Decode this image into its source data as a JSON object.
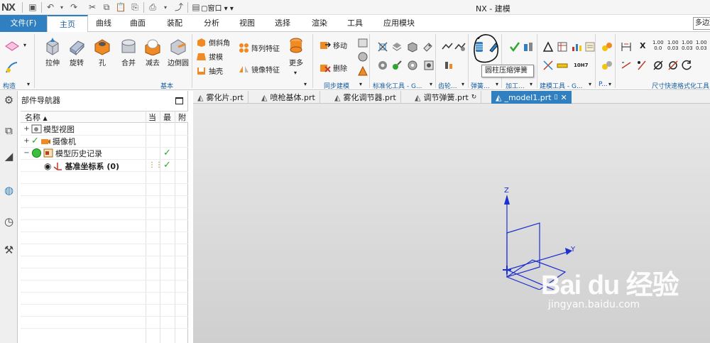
{
  "titlebar": {
    "logo": "NX",
    "title": "NX - 建模",
    "window_menu": "窗口"
  },
  "menubar": {
    "file_tab": "文件(F)",
    "tabs": [
      "主页",
      "曲线",
      "曲面",
      "装配",
      "分析",
      "视图",
      "选择",
      "渲染",
      "工具",
      "应用模块"
    ],
    "search_placeholder": "多边形"
  },
  "ribbon": {
    "group_labels": {
      "construct": "构造",
      "basic": "基本",
      "sync": "同步建模",
      "standard_parts": "标准化工具 - G...",
      "gear": "齿轮...",
      "spring": "弹簧...",
      "machining": "加工...",
      "build_tools": "建模工具 - G...",
      "p": "P...",
      "dimension": "尺寸快速格式化工具"
    },
    "big_buttons": {
      "extrude": "拉伸",
      "revolve": "旋转",
      "hole": "孔",
      "unite": "合并",
      "subtract": "减去",
      "edge_blend": "边倒圆",
      "more": "更多"
    },
    "small_buttons": {
      "chamfer": "倒斜角",
      "draft": "拔模",
      "shell": "抽壳",
      "pattern": "阵列特征",
      "mirror": "镜像特征",
      "move": "移动",
      "delete": "删除"
    },
    "dim_labels": {
      "x": "X",
      "d1": "1.00",
      "d2": "1.00",
      "d3": "1.00",
      "d4": "1.00",
      "d1b": "0.0",
      "d2b": "0.03",
      "d3b": "0.03",
      "d4b": "0.03"
    },
    "fit_label": "10H7",
    "tooltip": "圆柱压缩弹簧"
  },
  "navigator": {
    "title": "部件导航器",
    "columns": {
      "name": "名称",
      "current": "当",
      "latest": "最",
      "attached": "附"
    },
    "rows": {
      "model_views": "模型视图",
      "cameras": "摄像机",
      "model_history": "模型历史记录",
      "datum_csys": "基准坐标系 (0)"
    }
  },
  "file_tabs": [
    "雾化片.prt",
    "喷枪基体.prt",
    "雾化调节器.prt",
    "调节弹簧.prt",
    "_model1.prt"
  ],
  "viewport": {
    "axis_z": "Z",
    "axis_y": "Y"
  },
  "watermark": {
    "logo": "Bai du 经验",
    "url": "jingyan.baidu.com"
  },
  "colors": {
    "accent": "#2f7fc1",
    "check": "#2fa62f",
    "axes": "#1d2fd0"
  }
}
